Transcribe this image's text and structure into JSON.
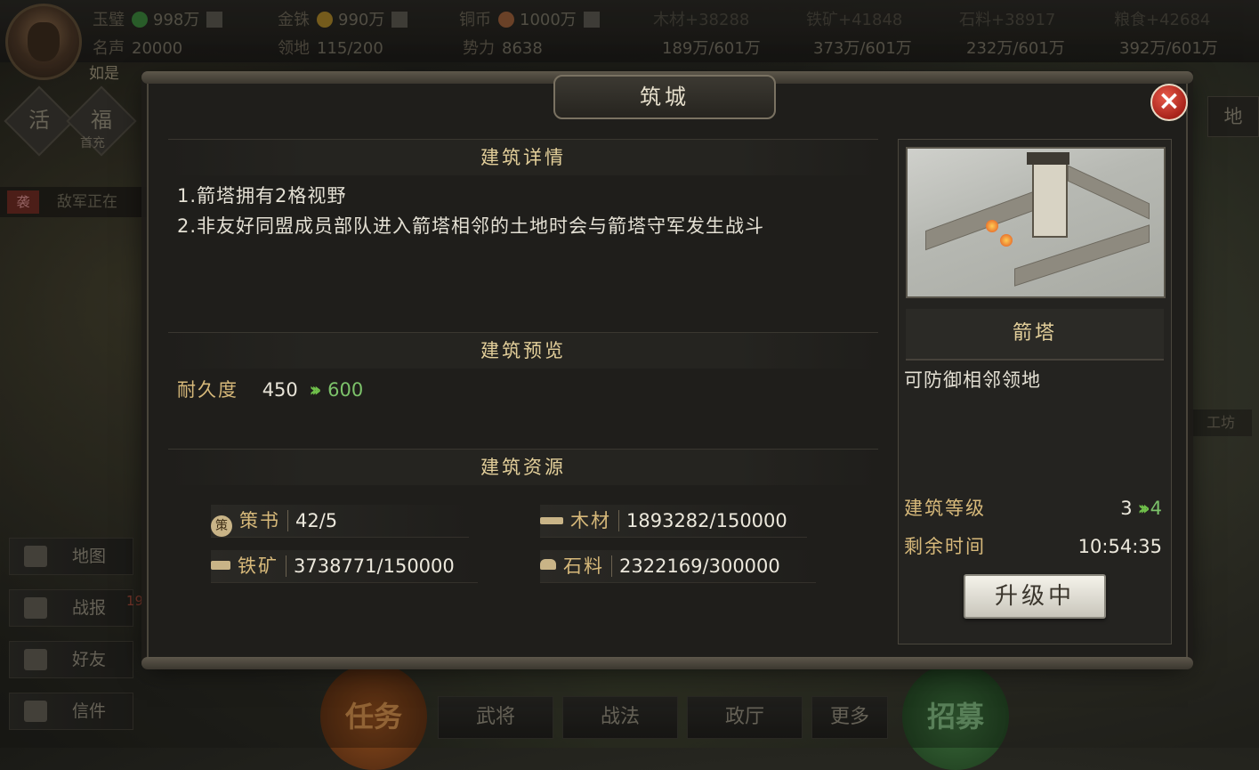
{
  "hud": {
    "jade": {
      "label": "玉璧",
      "value": "998万"
    },
    "gold": {
      "label": "金铢",
      "value": "990万"
    },
    "copper": {
      "label": "铜币",
      "value": "1000万"
    },
    "wood": {
      "label": "木材+38288",
      "cap": "189万/601万"
    },
    "iron": {
      "label": "铁矿+41848",
      "cap": "373万/601万"
    },
    "stone": {
      "label": "石料+38917",
      "cap": "232万/601万"
    },
    "grain": {
      "label": "粮食+42684",
      "cap": "392万/601万"
    },
    "fame": {
      "label": "名声",
      "value": "20000"
    },
    "territory": {
      "label": "领地",
      "value": "115/200"
    },
    "power": {
      "label": "势力",
      "value": "8638"
    },
    "player_name": "如是",
    "badges": [
      "活",
      "福"
    ],
    "first_charge": "首充",
    "notice_tag": "袭",
    "notice_text": "敌军正在",
    "right_tab": "地",
    "workshop": "工坊",
    "side_menu": [
      {
        "label": "地图"
      },
      {
        "label": "战报"
      },
      {
        "label": "好友"
      },
      {
        "label": "信件"
      }
    ],
    "battle_report_count": "19",
    "bottom_menu": {
      "task": "任务",
      "generals": "武将",
      "tactics": "战法",
      "hall": "政厅",
      "more": "更多",
      "recruit": "招募"
    }
  },
  "dialog": {
    "title": "筑城",
    "close_icon": "close-icon",
    "details_header": "建筑详情",
    "details": [
      "1.箭塔拥有2格视野",
      "2.非友好同盟成员部队进入箭塔相邻的土地时会与箭塔守军发生战斗"
    ],
    "preview_header": "建筑预览",
    "durability_label": "耐久度",
    "durability_current": "450",
    "durability_next": "600",
    "resources_header": "建筑资源",
    "resources": {
      "book": {
        "icon": "策",
        "name": "策书",
        "value": "42/5"
      },
      "wood": {
        "name": "木材",
        "value": "1893282/150000"
      },
      "iron": {
        "name": "铁矿",
        "value": "3738771/150000"
      },
      "stone": {
        "name": "石料",
        "value": "2322169/300000"
      }
    },
    "building_name": "箭塔",
    "building_desc": "可防御相邻领地",
    "level_label": "建筑等级",
    "level_current": "3",
    "level_next": "4",
    "time_label": "剩余时间",
    "time_value": "10:54:35",
    "upgrade_button": "升级中"
  }
}
